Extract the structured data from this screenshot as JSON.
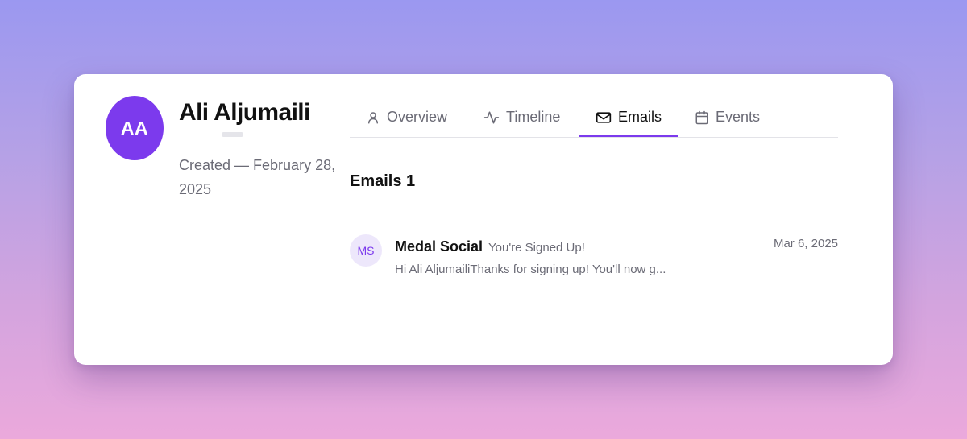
{
  "contact": {
    "initials": "AA",
    "name": "Ali Aljumaili",
    "created": "Created — February 28, 2025"
  },
  "tabs": [
    {
      "label": "Overview",
      "icon": "user-icon",
      "active": false
    },
    {
      "label": "Timeline",
      "icon": "activity-icon",
      "active": false
    },
    {
      "label": "Emails",
      "icon": "mail-icon",
      "active": true
    },
    {
      "label": "Events",
      "icon": "calendar-icon",
      "active": false
    }
  ],
  "emails_section": {
    "title": "Emails 1",
    "items": [
      {
        "initials": "MS",
        "sender": "Medal Social",
        "subject": "You're Signed Up!",
        "date": "Mar 6, 2025",
        "preview": "Hi Ali AljumailiThanks for signing up! You'll now g..."
      }
    ]
  },
  "colors": {
    "accent": "#7c3aed",
    "avatar_bg": "#7c3aed",
    "sender_avatar_bg": "#ede7fb",
    "muted_text": "#6b6b76"
  }
}
